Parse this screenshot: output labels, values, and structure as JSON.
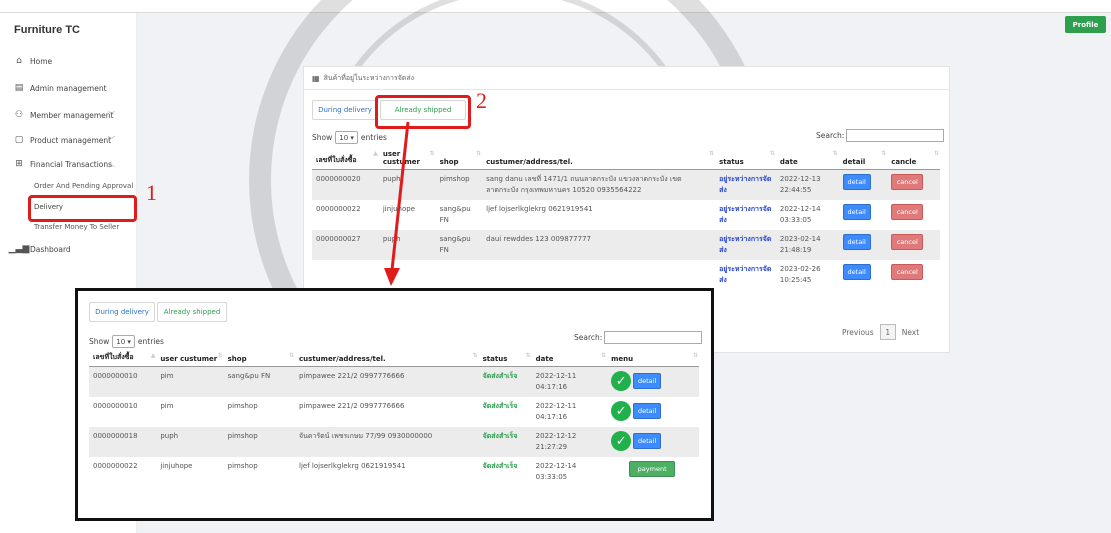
{
  "app": {
    "brand": "Furniture TC",
    "profile_label": "Profile"
  },
  "sidebar": {
    "items": [
      {
        "label": "Home"
      },
      {
        "label": "Admin management"
      },
      {
        "label": "Member management"
      },
      {
        "label": "Product management"
      },
      {
        "label": "Financial Transactions"
      },
      {
        "label": "Dashboard"
      }
    ],
    "sub_items": [
      {
        "label": "Order And Pending Approval"
      },
      {
        "label": "Delivery"
      },
      {
        "label": "Transfer Money To Seller"
      }
    ]
  },
  "card": {
    "title": "สินค้าที่อยู่ในระหว่างการจัดส่ง",
    "tabs": [
      {
        "label": "During delivery"
      },
      {
        "label": "Already shipped"
      }
    ],
    "show_label": "Show",
    "entries_value": "10",
    "entries_label": "entries",
    "search_label": "Search:",
    "columns": [
      "เลขที่ใบสั่งซื้อ",
      "user custumer",
      "shop",
      "custumer/address/tel.",
      "status",
      "date",
      "detail",
      "cancle"
    ],
    "rows": [
      {
        "order": "0000000020",
        "user": "puph",
        "shop": "pimshop",
        "address": "sang danu เลขที่ 1471/1 ถนนลาดกระบัง แขวงลาดกระบัง เขตลาดกระบัง กรุงเทพมหานคร 10520 0935564222",
        "status": "อยู่ระหว่างการจัดส่ง",
        "date": "2022-12-13",
        "time": "22:44:55",
        "detail": "detail",
        "cancel": "cancel"
      },
      {
        "order": "0000000022",
        "user": "jinjuhope",
        "shop": "sang&pu FN",
        "address": "ljef lojserlkglekrg 0621919541",
        "status": "อยู่ระหว่างการจัดส่ง",
        "date": "2022-12-14",
        "time": "03:33:05",
        "detail": "detail",
        "cancel": "cancel"
      },
      {
        "order": "0000000027",
        "user": "puph",
        "shop": "sang&pu FN",
        "address": "daui rewddes 123 009877777",
        "status": "อยู่ระหว่างการจัดส่ง",
        "date": "2023-02-14",
        "time": "21:48:19",
        "detail": "detail",
        "cancel": "cancel"
      },
      {
        "order": "",
        "user": "",
        "shop": "",
        "address": "",
        "status": "อยู่ระหว่างการจัดส่ง",
        "date": "2023-02-26",
        "time": "10:25:45",
        "detail": "detail",
        "cancel": "cancel"
      }
    ],
    "pager": {
      "previous": "Previous",
      "page": "1",
      "next": "Next"
    }
  },
  "inset": {
    "tabs": [
      {
        "label": "During delivery"
      },
      {
        "label": "Already shipped"
      }
    ],
    "show_label": "Show",
    "entries_value": "10",
    "entries_label": "entries",
    "search_label": "Search:",
    "columns": [
      "เลขที่ใบสั่งซื้อ",
      "user custumer",
      "shop",
      "custumer/address/tel.",
      "status",
      "date",
      "menu"
    ],
    "rows": [
      {
        "order": "0000000010",
        "user": "pim",
        "shop": "sang&pu FN",
        "address": "pimpawee 221/2 0997776666",
        "status": "จัดส่งสำเร็จ",
        "date": "2022-12-11",
        "time": "04:17:16",
        "action": "detail"
      },
      {
        "order": "0000000010",
        "user": "pim",
        "shop": "pimshop",
        "address": "pimpawee 221/2 0997776666",
        "status": "จัดส่งสำเร็จ",
        "date": "2022-12-11",
        "time": "04:17:16",
        "action": "detail"
      },
      {
        "order": "0000000018",
        "user": "puph",
        "shop": "pimshop",
        "address": "จันดารัตน์ เพชรเกษม 77/99 0930000000",
        "status": "จัดส่งสำเร็จ",
        "date": "2022-12-12",
        "time": "21:27:29",
        "action": "detail"
      },
      {
        "order": "0000000022",
        "user": "jinjuhope",
        "shop": "pimshop",
        "address": "ljef lojserlkglekrg 0621919541",
        "status": "จัดส่งสำเร็จ",
        "date": "2022-12-14",
        "time": "03:33:05",
        "action": "payment"
      }
    ]
  },
  "annotations": {
    "callout1": "1",
    "callout2": "2"
  },
  "colors": {
    "accent_red": "#e01b1b",
    "profile_green": "#2e9e4f",
    "status_blue": "#2947c9",
    "status_green": "#2e9e4f",
    "detail_blue": "#3d8bfd",
    "cancel_red": "#e07a7a"
  }
}
